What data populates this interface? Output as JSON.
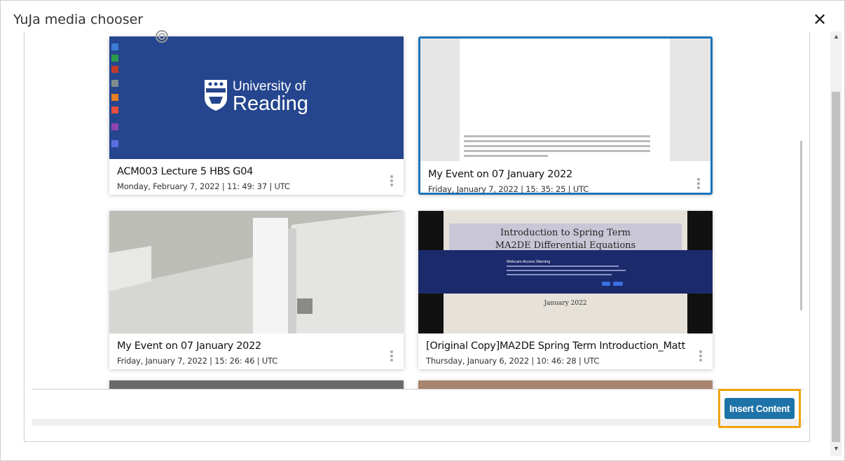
{
  "dialog": {
    "title": "YuJa media chooser",
    "close_label": "✕"
  },
  "cards": [
    {
      "title": "ACM003 Lecture 5 HBS G04",
      "date": "Monday, February 7, 2022 | 11: 49: 37 | UTC",
      "thumb_text_1": "University of",
      "thumb_text_2": "Reading",
      "selected": false
    },
    {
      "title": "My Event on 07 January 2022",
      "date": "Friday, January 7, 2022 | 15: 35: 25 | UTC",
      "selected": true
    },
    {
      "title": "My Event on 07 January 2022",
      "date": "Friday, January 7, 2022 | 15: 26: 46 | UTC",
      "selected": false
    },
    {
      "title": "[Original Copy]MA2DE Spring Term Introduction_Matt",
      "date": "Thursday, January 6, 2022 | 10: 46: 28 | UTC",
      "thumb_heading_1": "Introduction to Spring Term",
      "thumb_heading_2": "MA2DE Differential Equations",
      "thumb_dialog_title": "Webcam Access Warning",
      "thumb_footer": "January 2022",
      "selected": false
    }
  ],
  "footer": {
    "insert_label": "Insert Content"
  },
  "colors": {
    "accent": "#1b75bc",
    "button": "#1e73a8",
    "highlight": "#f0a30a",
    "uor_blue": "#25468e"
  }
}
